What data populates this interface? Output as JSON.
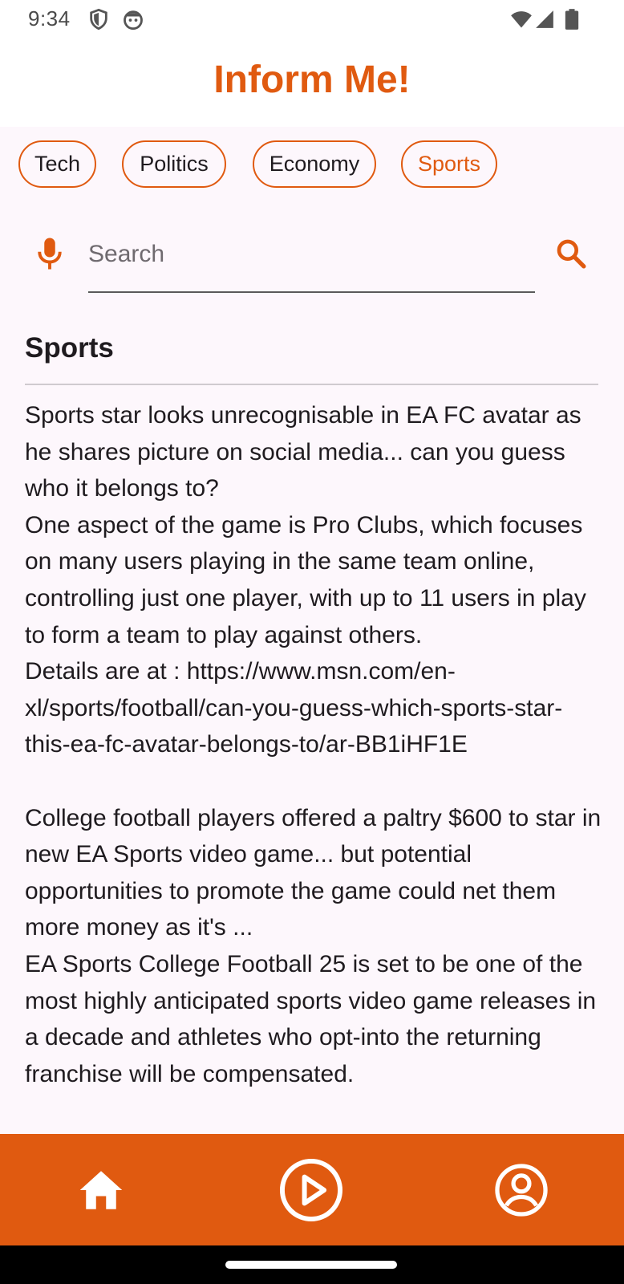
{
  "status_bar": {
    "time": "9:34"
  },
  "app": {
    "title": "Inform Me!"
  },
  "categories": [
    {
      "label": "Tech",
      "active": false
    },
    {
      "label": "Politics",
      "active": false
    },
    {
      "label": "Economy",
      "active": false
    },
    {
      "label": "Sports",
      "active": true
    }
  ],
  "search": {
    "placeholder": "Search",
    "value": ""
  },
  "section": {
    "title": "Sports"
  },
  "articles": [
    {
      "headline": "Sports star looks unrecognisable in EA FC avatar as he shares picture on social media... can you guess who it belongs to?",
      "summary": "One aspect of the game is Pro Clubs, which focuses on many users playing in the same team online, controlling just one player, with up to 11 users in play to form a team to play against others.",
      "details": "Details are at : https://www.msn.com/en-xl/sports/football/can-you-guess-which-sports-star-this-ea-fc-avatar-belongs-to/ar-BB1iHF1E"
    },
    {
      "headline": "College football players offered a paltry $600 to star in new EA Sports video game... but potential opportunities to promote the game could net them more money as it's ...",
      "summary": "EA Sports College Football 25 is set to be one of the most highly anticipated sports video game releases in a decade and athletes who opt-into the returning franchise will be compensated."
    }
  ],
  "colors": {
    "accent": "#e05a10",
    "background": "#fdf7fc",
    "text": "#1f1b1f"
  },
  "icons": {
    "mic": "mic-icon",
    "search": "search-icon",
    "home": "home-icon",
    "play": "play-circle-icon",
    "profile": "account-circle-icon"
  }
}
